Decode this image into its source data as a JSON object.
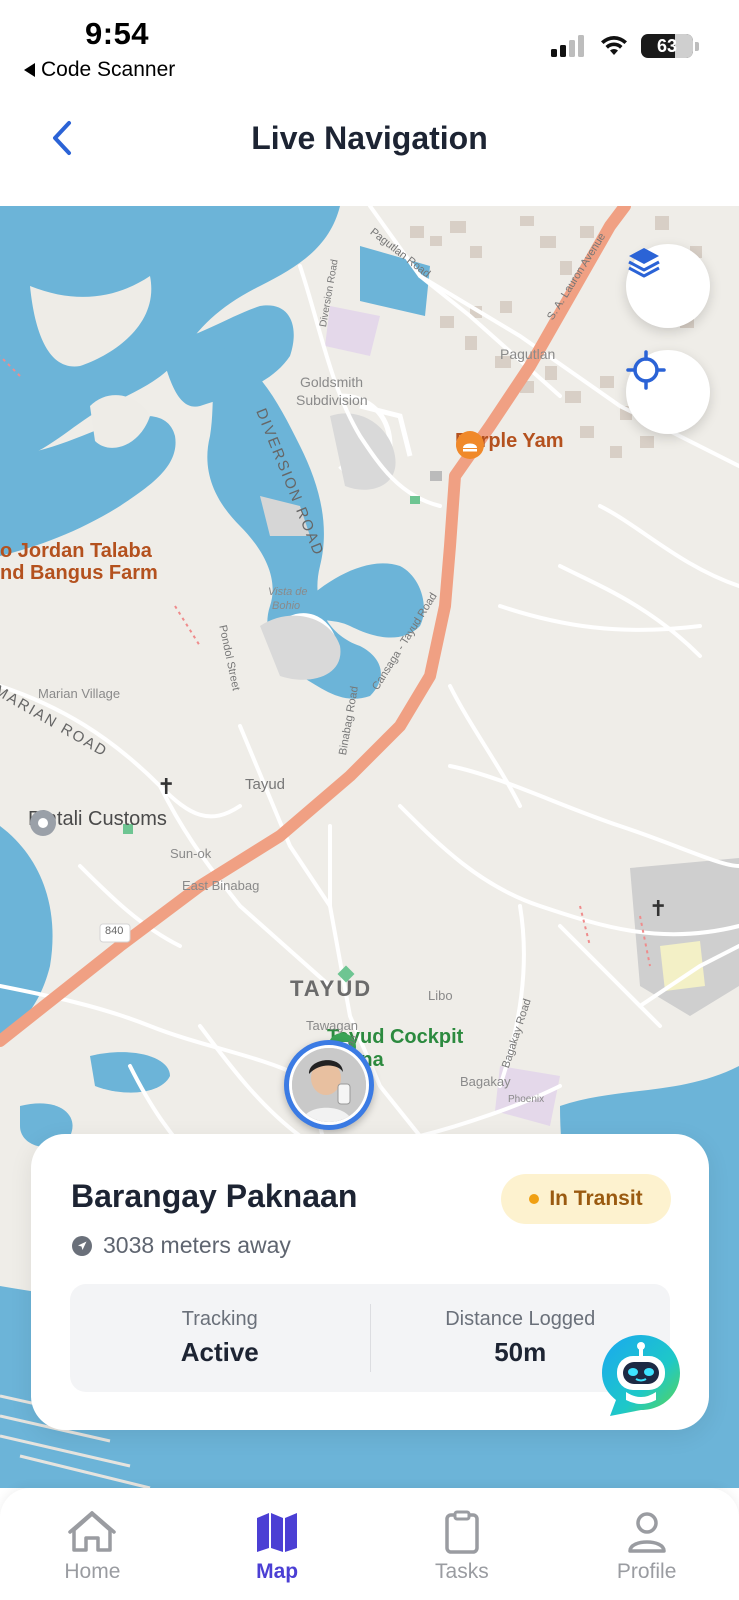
{
  "status_bar": {
    "time": "9:54",
    "back_app": "Code Scanner",
    "battery": "63"
  },
  "header": {
    "title": "Live Navigation"
  },
  "map": {
    "labels": {
      "purple_yam": "Purple Yam",
      "jordan_1": "o Jordan Talaba",
      "jordan_2": "nd Bangus Farm",
      "pintali": "Pintali Customs",
      "cockpit_1": "Tayud Cockpit",
      "cockpit_2": "Arena",
      "district": "TAYUD",
      "tayud_small": "Tayud",
      "diversion_road": "DIVERSION ROAD",
      "marian_road": "MARIAN ROAD",
      "goldsmith": "Goldsmith",
      "subdivision": "Subdivision",
      "pagutlan": "Pagutlan",
      "pagutlan_road": "Pagutlan Road",
      "lauron": "S. A. Lauron Avenue",
      "consolacion_road": "Cansaga - Tayud Road",
      "vista_1": "Vista de",
      "vista_2": "Bohio",
      "pondol": "Pondol Street",
      "marian_village": "Marian Village",
      "binabag_road": "Binabag Road",
      "sun_ok": "Sun-ok",
      "east_binabag": "East Binabag",
      "route_840": "840",
      "libo": "Libo",
      "tawagan": "Tawagan",
      "sitio_tawagan": "Sitio Tawagan",
      "bagakay": "Bagakay",
      "bagakay_road": "Bagakay Road",
      "phoenix": "Phoenix",
      "diversion_small": "Diversion Road"
    },
    "buttons": {
      "layers_icon": "layers-icon",
      "locate_icon": "crosshair-icon"
    }
  },
  "card": {
    "destination": "Barangay Paknaan",
    "distance": "3038 meters away",
    "status": "In Transit",
    "tracking_label": "Tracking",
    "tracking_value": "Active",
    "distance_label": "Distance Logged",
    "distance_value": "50m"
  },
  "nav": {
    "items": [
      {
        "label": "Home",
        "icon": "home-icon"
      },
      {
        "label": "Map",
        "icon": "map-icon"
      },
      {
        "label": "Tasks",
        "icon": "clipboard-icon"
      },
      {
        "label": "Profile",
        "icon": "user-icon"
      }
    ],
    "active": "Map"
  },
  "colors": {
    "accent": "#3b7be4",
    "nav_active": "#4b3fd4",
    "route": "#f0a083",
    "water": "#6fb6d8",
    "pill_bg": "#fdf2cf"
  }
}
